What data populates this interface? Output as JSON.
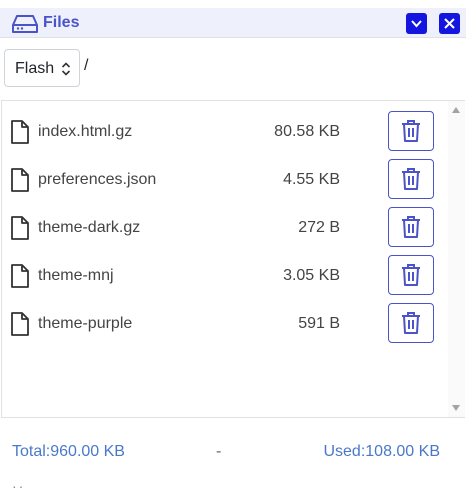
{
  "header": {
    "title": "Files",
    "icon": "drive-icon",
    "accent_color": "#4a54c8",
    "button_color": "#1515e0"
  },
  "toolbar": {
    "filesystem_selected": "Flash",
    "current_path": "/"
  },
  "files": [
    {
      "name": "index.html.gz",
      "size": "80.58 KB"
    },
    {
      "name": "preferences.json",
      "size": "4.55 KB"
    },
    {
      "name": "theme-dark.gz",
      "size": "272 B"
    },
    {
      "name": "theme-mnj",
      "size": "3.05 KB"
    },
    {
      "name": "theme-purple",
      "size": "591 B"
    }
  ],
  "footer": {
    "total": "Total:960.00 KB",
    "separator": "-",
    "used": "Used:108.00 KB"
  }
}
